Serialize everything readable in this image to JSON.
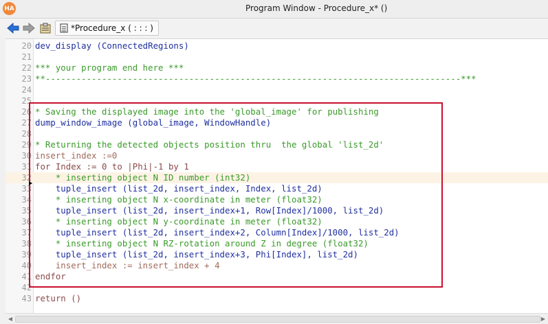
{
  "window": {
    "title": "Program Window - Procedure_x* ()",
    "app_icon_text": "HA"
  },
  "toolbar": {
    "tab_label": "*Procedure_x ( : : : )"
  },
  "colors": {
    "comment": "#3a9a2a",
    "operator": "#1f2f9f",
    "keyword": "#8a4a4a",
    "highlight_box": "#c8102e",
    "current_line": "#fdf3e5"
  },
  "editor": {
    "lines": [
      {
        "num": "20",
        "segments": [
          {
            "t": "op",
            "text": "dev_display (ConnectedRegions)"
          }
        ]
      },
      {
        "num": "21",
        "segments": []
      },
      {
        "num": "22",
        "segments": [
          {
            "t": "comment",
            "text": "*** your program end here ***"
          }
        ]
      },
      {
        "num": "23",
        "segments": [
          {
            "t": "comment",
            "text": "**---------------------------------------------------------------------------------***"
          }
        ]
      },
      {
        "num": "24",
        "segments": []
      },
      {
        "num": "25",
        "segments": []
      },
      {
        "num": "26",
        "segments": [
          {
            "t": "comment",
            "text": "* Saving the displayed image into the 'global_image' for publishing"
          }
        ]
      },
      {
        "num": "27",
        "segments": [
          {
            "t": "op",
            "text": "dump_window_image (global_image, WindowHandle)"
          }
        ]
      },
      {
        "num": "28",
        "segments": []
      },
      {
        "num": "29",
        "segments": [
          {
            "t": "comment",
            "text": "* Returning the detected objects position thru  the global 'list_2d'"
          }
        ]
      },
      {
        "num": "30",
        "segments": [
          {
            "t": "plain",
            "text": "insert_index :=0"
          }
        ]
      },
      {
        "num": "31",
        "segments": [
          {
            "t": "kw",
            "text": "for Index := 0 to |Phi|-1 by 1"
          }
        ]
      },
      {
        "num": "32",
        "highlight": true,
        "segments": [
          {
            "t": "comment",
            "text": "    * inserting object N ID number (int32)"
          }
        ]
      },
      {
        "num": "33",
        "segments": [
          {
            "t": "op",
            "text": "    tuple_insert (list_2d, insert_index, Index, list_2d)"
          }
        ]
      },
      {
        "num": "34",
        "segments": [
          {
            "t": "comment",
            "text": "    * inserting object N x-coordinate in meter (float32)"
          }
        ]
      },
      {
        "num": "35",
        "segments": [
          {
            "t": "op",
            "text": "    tuple_insert (list_2d, insert_index+1, Row[Index]/1000, list_2d)"
          }
        ]
      },
      {
        "num": "36",
        "segments": [
          {
            "t": "comment",
            "text": "    * inserting object N y-coordinate in meter (float32)"
          }
        ]
      },
      {
        "num": "37",
        "segments": [
          {
            "t": "op",
            "text": "    tuple_insert (list_2d, insert_index+2, Column[Index]/1000, list_2d)"
          }
        ]
      },
      {
        "num": "38",
        "segments": [
          {
            "t": "comment",
            "text": "    * inserting object N RZ-rotation around Z in degree (float32)"
          }
        ]
      },
      {
        "num": "39",
        "segments": [
          {
            "t": "op",
            "text": "    tuple_insert (list_2d, insert_index+3, Phi[Index], list_2d)"
          }
        ]
      },
      {
        "num": "40",
        "segments": [
          {
            "t": "plain",
            "text": "    insert_index := insert_index + 4"
          }
        ]
      },
      {
        "num": "41",
        "segments": [
          {
            "t": "kw",
            "text": "endfor"
          }
        ]
      },
      {
        "num": "42",
        "segments": []
      },
      {
        "num": "43",
        "segments": [
          {
            "t": "kw",
            "text": "return ()"
          }
        ]
      }
    ]
  }
}
